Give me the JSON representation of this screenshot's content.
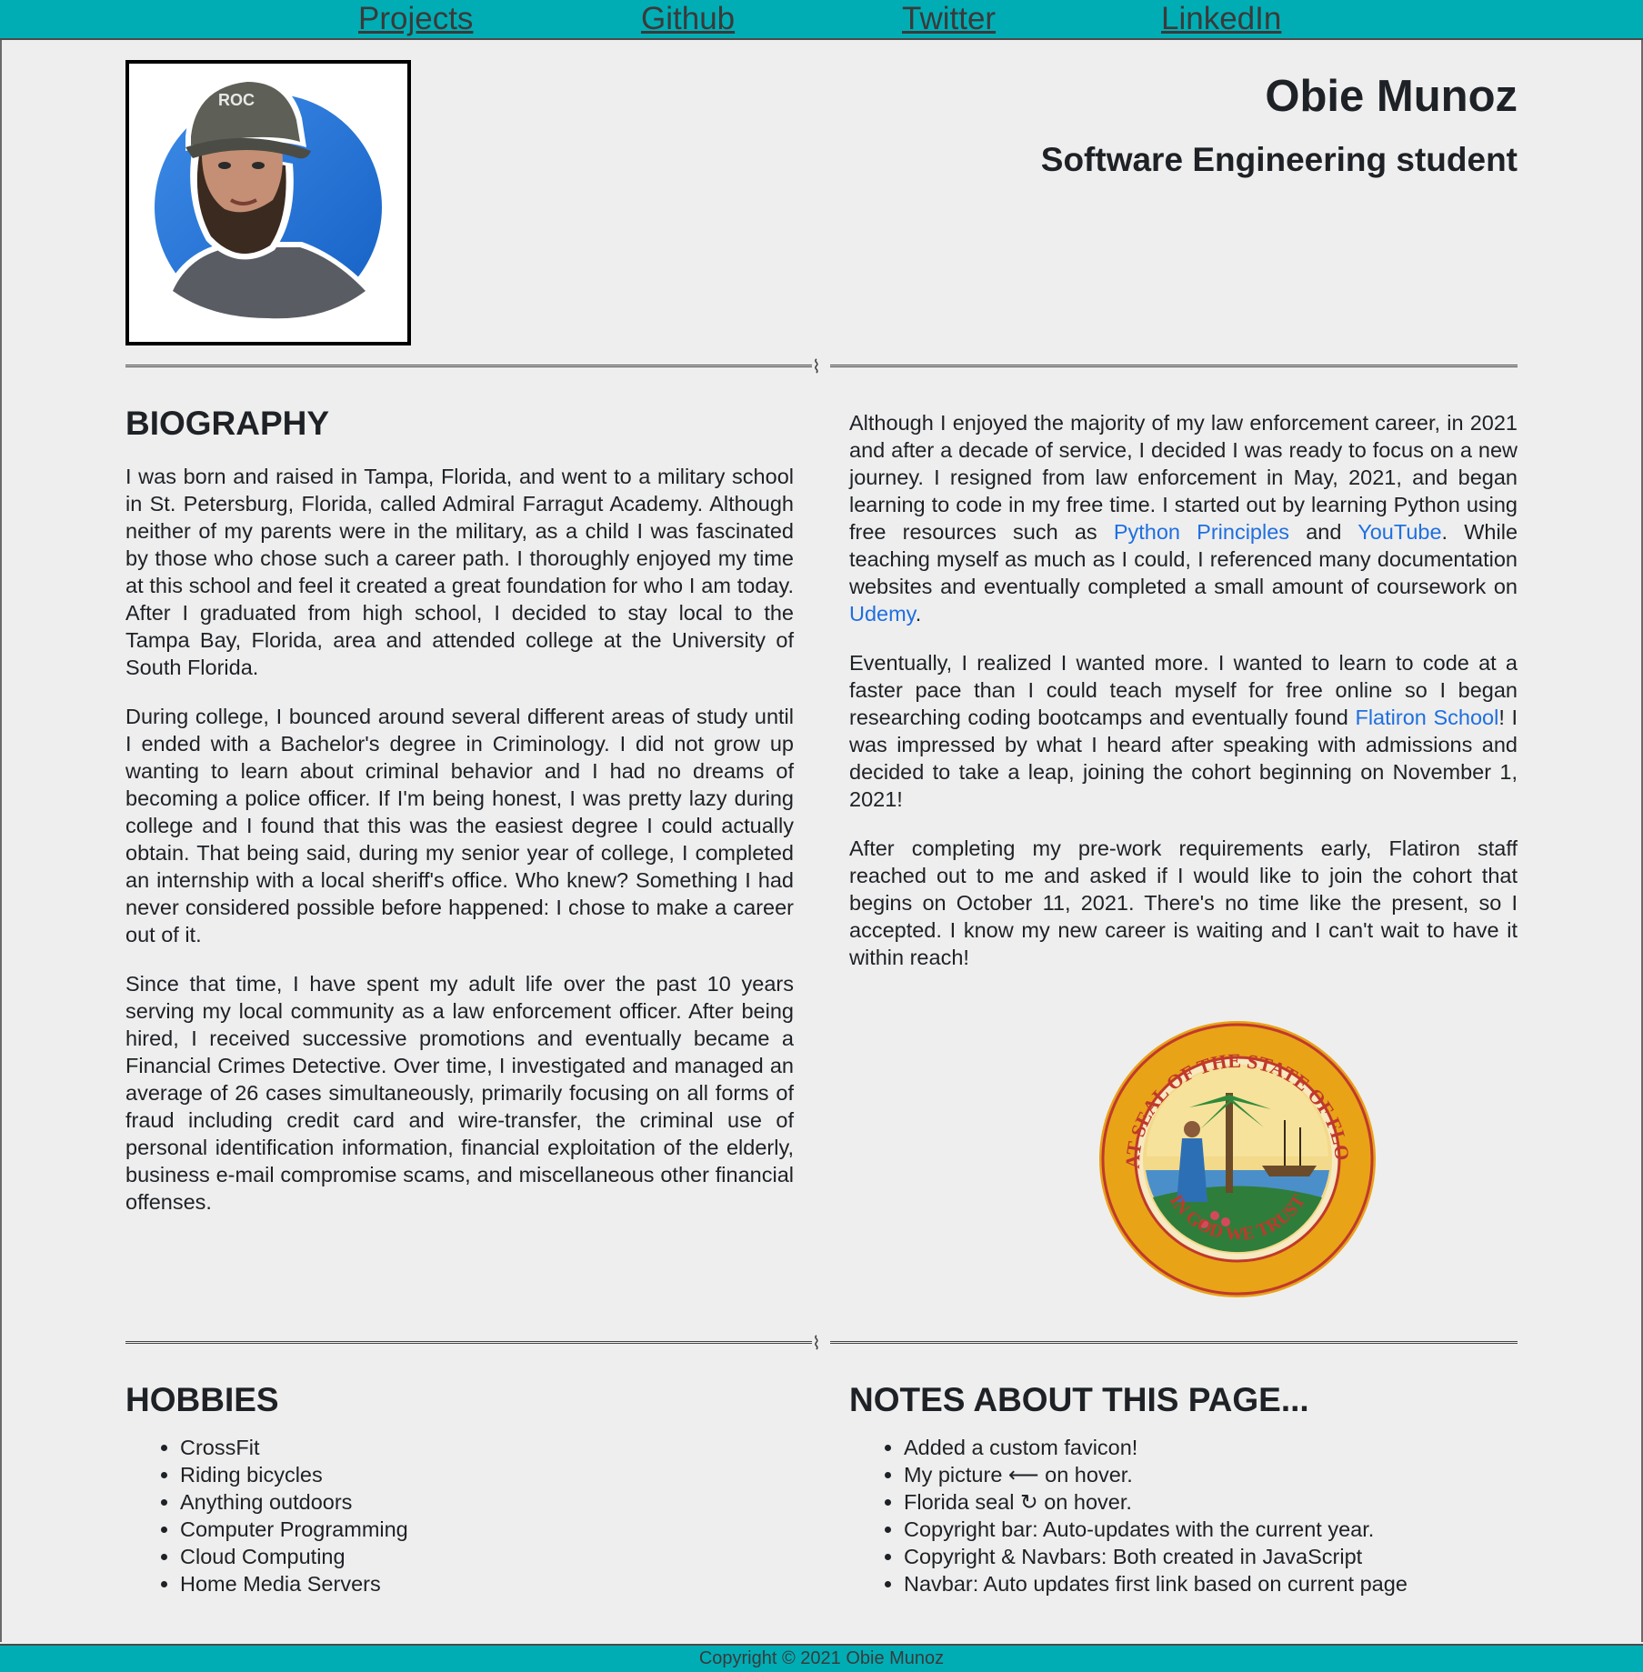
{
  "nav": {
    "links": [
      "Projects",
      "Github",
      "Twitter",
      "LinkedIn"
    ]
  },
  "header": {
    "name": "Obie Munoz",
    "subtitle": "Software Engineering student"
  },
  "biography": {
    "heading": "BIOGRAPHY",
    "p1": "I was born and raised in Tampa, Florida, and went to a military school in St. Petersburg, Florida, called Admiral Farragut Academy. Although neither of my parents were in the military, as a child I was fascinated by those who chose such a career path. I thoroughly enjoyed my time at this school and feel it created a great foundation for who I am today. After I graduated from high school, I decided to stay local to the Tampa Bay, Florida, area and attended college at the University of South Florida.",
    "p2": "During college, I bounced around several different areas of study until I ended with a Bachelor's degree in Criminology. I did not grow up wanting to learn about criminal behavior and I had no dreams of becoming a police officer. If I'm being honest, I was pretty lazy during college and I found that this was the easiest degree I could actually obtain. That being said, during my senior year of college, I completed an internship with a local sheriff's office. Who knew? Something I had never considered possible before happened: I chose to make a career out of it.",
    "p3": "Since that time, I have spent my adult life over the past 10 years serving my local community as a law enforcement officer. After being hired, I received successive promotions and eventually became a Financial Crimes Detective. Over time, I investigated and managed an average of 26 cases simultaneously, primarily focusing on all forms of fraud including credit card and wire-transfer, the criminal use of personal identification information, financial exploitation of the elderly, business e-mail compromise scams, and miscellaneous other financial offenses.",
    "p4_a": "Although I enjoyed the majority of my law enforcement career, in 2021 and after a decade of service, I decided I was ready to focus on a new journey. I resigned from law enforcement in May, 2021, and began learning to code in my free time. I started out by learning Python using free resources such as ",
    "p4_link1": "Python Principles",
    "p4_b": " and ",
    "p4_link2": "YouTube",
    "p4_c": ". While teaching myself as much as I could, I referenced many documentation websites and eventually completed a small amount of coursework on ",
    "p4_link3": "Udemy",
    "p4_d": ".",
    "p5_a": "Eventually, I realized I wanted more. I wanted to learn to code at a faster pace than I could teach myself for free online so I began researching coding bootcamps and eventually found ",
    "p5_link": "Flatiron School",
    "p5_b": "! I was impressed by what I heard after speaking with admissions and decided to take a leap, joining the cohort beginning on November 1, 2021!",
    "p6": "After completing my pre-work requirements early, Flatiron staff reached out to me and asked if I would like to join the cohort that begins on October 11, 2021. There's no time like the present, so I accepted. I know my new career is waiting and I can't wait to have it within reach!"
  },
  "seal": {
    "outer_text": "GREAT SEAL OF THE STATE OF FLORIDA",
    "inner_text": "IN GOD WE TRUST"
  },
  "hobbies": {
    "heading": "HOBBIES",
    "items": [
      "CrossFit",
      "Riding bicycles",
      "Anything outdoors",
      "Computer Programming",
      "Cloud Computing",
      "Home Media Servers"
    ]
  },
  "notes": {
    "heading": "NOTES ABOUT THIS PAGE...",
    "items": [
      "Added a custom favicon!",
      "My picture ⟵ on hover.",
      "Florida seal ↻ on hover.",
      "Copyright bar: Auto-updates with the current year.",
      "Copyright & Navbars: Both created in JavaScript",
      "Navbar: Auto updates first link based on current page"
    ]
  },
  "footer": {
    "copyright": "Copyright © 2021 Obie Munoz"
  },
  "colors": {
    "bar": "#00adb5",
    "background": "#eeeeee",
    "link": "#1f6fe0"
  }
}
